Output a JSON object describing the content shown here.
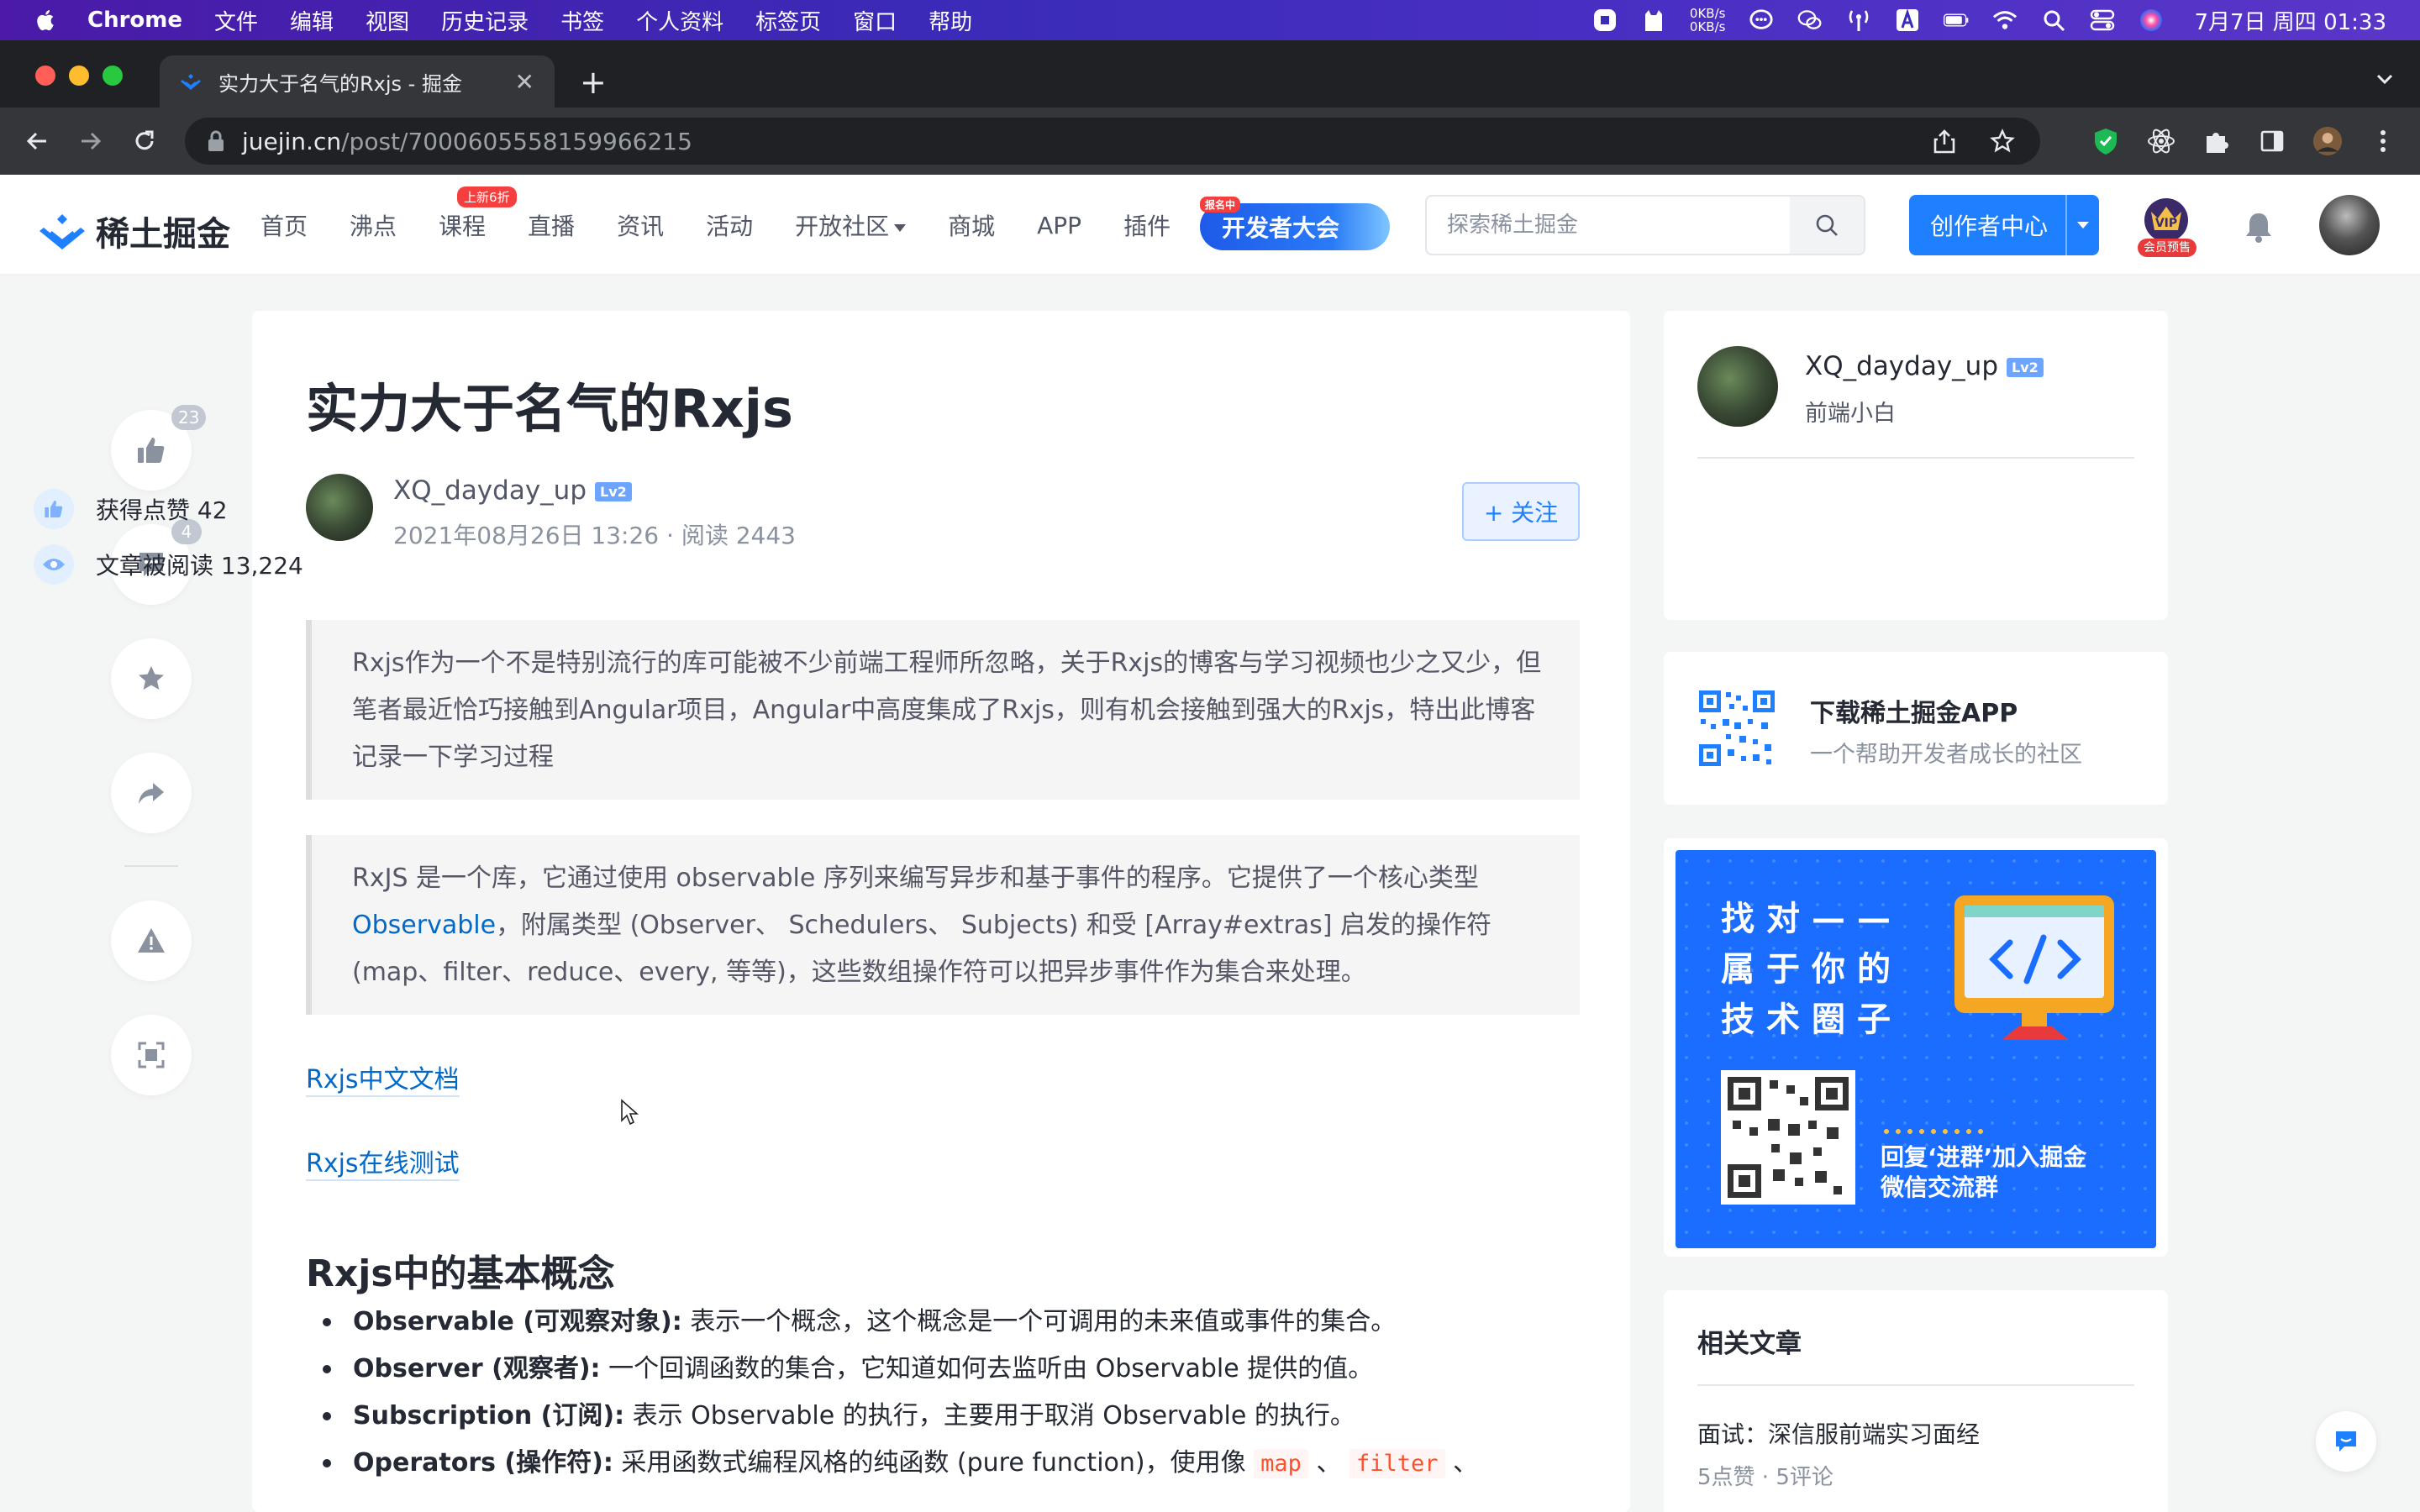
{
  "colors": {
    "brand": "#1e80ff",
    "link": "#0269c8",
    "badge_count": "#c2c8d1",
    "menubar": "#4b1aa8",
    "browser_dark": "#202124",
    "ad_blue": "#1a6dff"
  },
  "menubar": {
    "app": "Chrome",
    "items": [
      "文件",
      "编辑",
      "视图",
      "历史记录",
      "书签",
      "个人资料",
      "标签页",
      "窗口",
      "帮助"
    ],
    "net_up": "0KB/s",
    "net_down": "0KB/s",
    "clock": "7月7日 周四 01:33",
    "status_icons": [
      "record-icon",
      "cat-icon",
      "network-speed",
      "chat-icon",
      "wechat-icon",
      "antenna-icon",
      "text-a-icon",
      "battery-icon",
      "wifi-icon",
      "spotlight-search-icon",
      "control-center-icon",
      "siri-icon"
    ]
  },
  "browser": {
    "tab_title": "实力大于名气的Rxjs - 掘金",
    "new_tab": "+",
    "url_host": "juejin.cn",
    "url_path": "/post/7000605558159966215"
  },
  "header": {
    "logo_text": "稀土掘金",
    "nav": [
      "首页",
      "沸点",
      "课程",
      "直播",
      "资讯",
      "活动",
      "开放社区",
      "商城",
      "APP",
      "插件"
    ],
    "course_badge": "上新6折",
    "dev_conf": "开发者大会",
    "dev_conf_tag": "报名中",
    "search_placeholder": "探索稀土掘金",
    "creator_button": "创作者中心",
    "vip_label": "会员预售"
  },
  "float_panel": {
    "like_count": "23",
    "comment_count": "4"
  },
  "article": {
    "title": "实力大于名气的Rxjs",
    "author": "XQ_dayday_up",
    "level": "Lv2",
    "date": "2021年08月26日 13:26",
    "reads": "阅读 2443",
    "dot": "·",
    "follow": "+ 关注",
    "quote1": "Rxjs作为一个不是特别流行的库可能被不少前端工程师所忽略，关于Rxjs的博客与学习视频也少之又少，但笔者最近恰巧接触到Angular项目，Angular中高度集成了Rxjs，则有机会接触到强大的Rxjs，特出此博客记录一下学习过程",
    "quote2_a": "RxJS 是一个库，它通过使用 observable 序列来编写异步和基于事件的程序。它提供了一个核心类型 ",
    "quote2_link": "Observable",
    "quote2_b": "，附属类型 (Observer、 Schedulers、 Subjects) 和受 [Array#extras] 启发的操作符 (map、filter、reduce、every, 等等)，这些数组操作符可以把异步事件作为集合来处理。",
    "link_docs": "Rxjs中文文档",
    "link_test": "Rxjs在线测试",
    "section_title": "Rxjs中的基本概念",
    "concepts": [
      {
        "term": "Observable (可观察对象):",
        "desc": " 表示一个概念，这个概念是一个可调用的未来值或事件的集合。"
      },
      {
        "term": "Observer (观察者):",
        "desc": " 一个回调函数的集合，它知道如何去监听由 Observable 提供的值。"
      },
      {
        "term": "Subscription (订阅):",
        "desc": " 表示 Observable 的执行，主要用于取消 Observable 的执行。"
      },
      {
        "term": "Operators (操作符):",
        "desc": " 采用函数式编程风格的纯函数 (pure function)，使用像 "
      }
    ],
    "code_map": "map",
    "code_filter": "filter",
    "sep1": " 、",
    "sep2": " 、"
  },
  "sidebar": {
    "author_name": "XQ_dayday_up",
    "level": "Lv2",
    "author_bio": "前端小白",
    "likes": "获得点赞 42",
    "reads": "文章被阅读 13,224",
    "app_title": "下载稀土掘金APP",
    "app_sub": "一个帮助开发者成长的社区",
    "ad_lines": [
      "找对——",
      "属于你的",
      "技术圈子"
    ],
    "ad_caption_1": "回复‘进群’加入掘金",
    "ad_caption_2": "微信交流群",
    "related_head": "相关文章",
    "related_title": "面试：深信服前端实习面经",
    "related_meta": "5点赞 · 5评论"
  }
}
